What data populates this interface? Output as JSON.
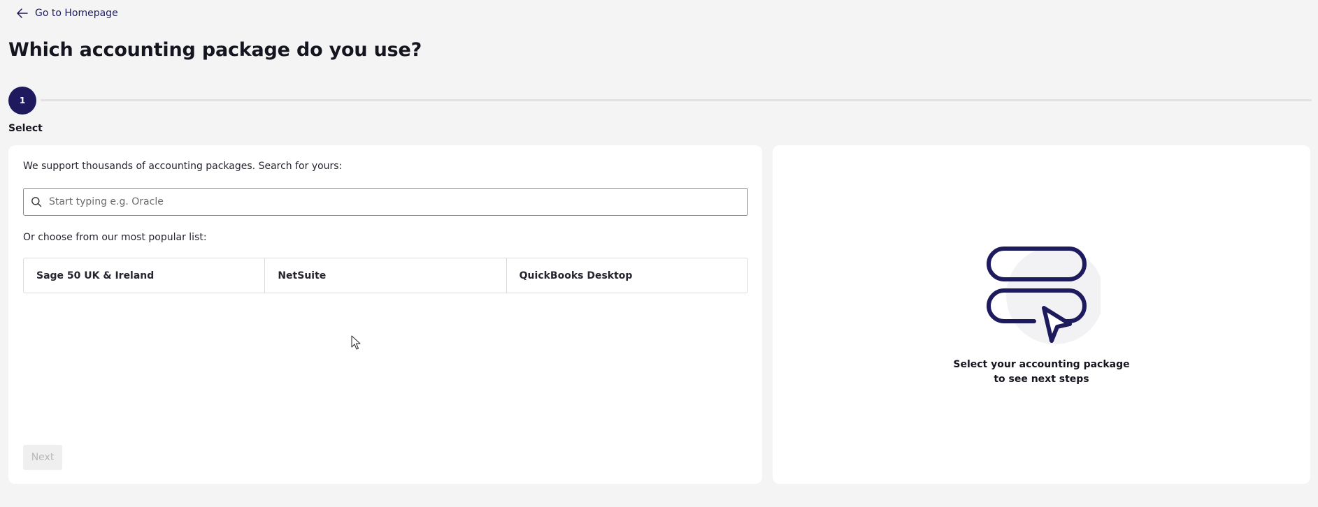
{
  "nav": {
    "back_label": "Go to Homepage",
    "back_icon": "arrow-left-icon"
  },
  "page": {
    "title": "Which accounting package do you use?"
  },
  "stepper": {
    "current_step": "1",
    "step_label": "Select"
  },
  "select_panel": {
    "search_hint": "We support thousands of accounting packages. Search for yours:",
    "search_placeholder": "Start typing e.g. Oracle",
    "search_value": "",
    "popular_hint": "Or choose from our most popular list:",
    "popular_items": [
      {
        "label": "Sage 50 UK & Ireland"
      },
      {
        "label": "NetSuite"
      },
      {
        "label": "QuickBooks Desktop"
      }
    ],
    "next_label": "Next"
  },
  "info_panel": {
    "message_line1": "Select your accounting package",
    "message_line2": "to see next steps",
    "illustration_icon": "server-stack-cursor-icon"
  },
  "colors": {
    "brand": "#1e1a5e",
    "background": "#f4f4f4",
    "card": "#ffffff"
  }
}
